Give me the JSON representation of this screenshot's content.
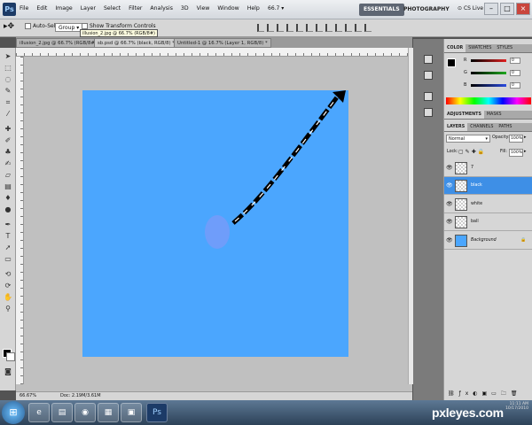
{
  "app": {
    "logo": "Ps"
  },
  "menu": [
    "File",
    "Edit",
    "Image",
    "Layer",
    "Select",
    "Filter",
    "Analysis",
    "3D",
    "View",
    "Window",
    "Help"
  ],
  "menubar": {
    "zoom": "66.7",
    "workspaces": [
      "ESSENTIALS",
      "PHOTOGRAPHY"
    ],
    "cslive": "CS Live"
  },
  "options": {
    "auto_select_label": "Auto-Select:",
    "auto_select_value": "Group",
    "show_transform": "Show Transform Controls"
  },
  "doc_tabs": [
    "illusion_2.jpg @ 66.7% (RGB/8#)",
    "sb.psd @ 66.7% (black, RGB/8) *",
    "Untitled-1 @ 16.7% (Layer 1, RGB/8) *"
  ],
  "tooltip": "illusion_2.jpg @ 66.7% (RGB/8#)",
  "status": {
    "zoom": "66.67%",
    "doc": "Doc: 2.19M/3.61M"
  },
  "color_panel": {
    "tabs": [
      "COLOR",
      "SWATCHES",
      "STYLES"
    ],
    "channels": [
      {
        "label": "R",
        "value": "0",
        "color": "#e02020"
      },
      {
        "label": "G",
        "value": "0",
        "color": "#1fa81f"
      },
      {
        "label": "B",
        "value": "0",
        "color": "#2a4be0"
      }
    ]
  },
  "adjust_tabs": [
    "ADJUSTMENTS",
    "MASKS"
  ],
  "layers_panel": {
    "tabs": [
      "LAYERS",
      "CHANNELS",
      "PATHS"
    ],
    "blend_mode": "Normal",
    "opacity_label": "Opacity:",
    "opacity": "100%",
    "lock_label": "Lock:",
    "fill_label": "Fill:",
    "fill": "100%",
    "layers": [
      {
        "name": "7",
        "selected": false,
        "thumb": "transparent"
      },
      {
        "name": "black",
        "selected": true,
        "thumb": "transparent"
      },
      {
        "name": "white",
        "selected": false,
        "thumb": "transparent"
      },
      {
        "name": "ball",
        "selected": false,
        "thumb": "transparent"
      },
      {
        "name": "Background",
        "selected": false,
        "thumb": "#4ba6fe",
        "locked": true
      }
    ]
  },
  "canvas": {
    "background": "#4ba6fe",
    "ball_color": "#6f9dfa"
  },
  "taskbar": {
    "watermark": "pxleyes.com",
    "tray_time": "11:11 AM",
    "tray_date": "10/17/2010"
  }
}
